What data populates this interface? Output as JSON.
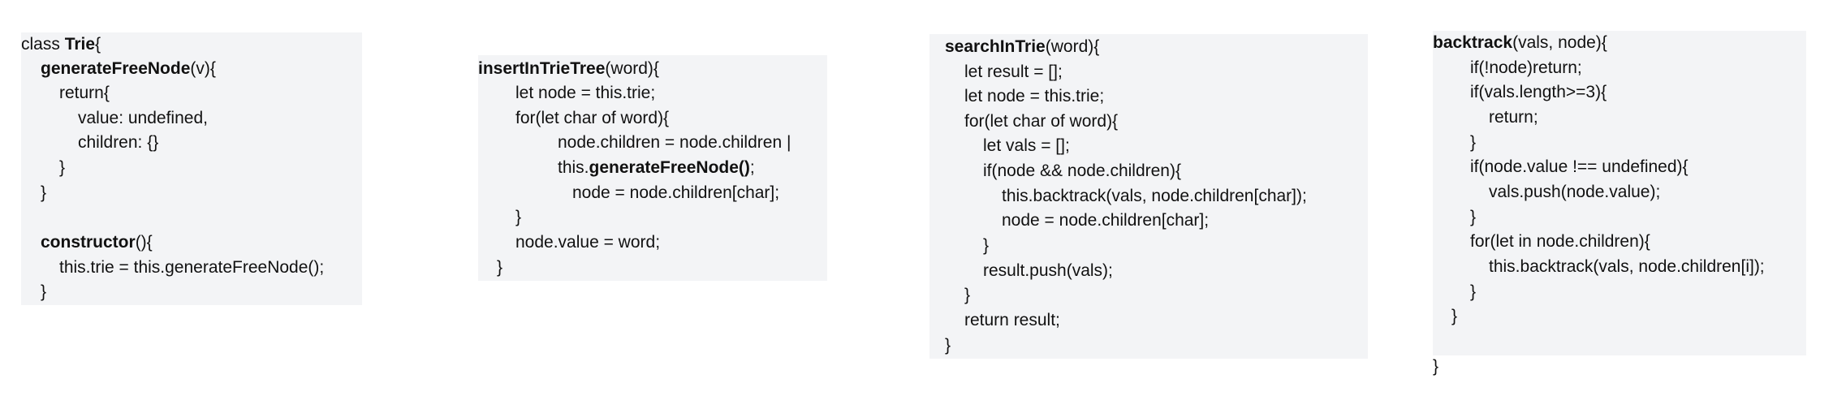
{
  "panels": [
    {
      "id": "trie-class",
      "lines": [
        [
          "class ",
          {
            "b": "Trie"
          },
          "{"
        ],
        [
          {
            "b": "generateFreeNode"
          },
          "(v){"
        ],
        [
          "return{"
        ],
        [
          "value: undefined,"
        ],
        [
          "children: {}"
        ],
        [
          "}"
        ],
        [
          "}"
        ],
        [
          ""
        ],
        [
          {
            "b": "constructor"
          },
          "(){"
        ],
        [
          "this.trie = this.generateFreeNode();"
        ],
        [
          "}"
        ]
      ]
    },
    {
      "id": "insert-in-trie-tree",
      "lines": [
        [
          {
            "b": "insertInTrieTree"
          },
          "(word){"
        ],
        [
          "let node = this.trie;"
        ],
        [
          "for(let char of word){"
        ],
        [
          "node.children = node.children |"
        ],
        [
          "this.",
          {
            "b": "generateFreeNode()"
          },
          ";"
        ],
        [
          "node = node.children[char];"
        ],
        [
          "}"
        ],
        [
          "node.value = word;"
        ],
        [
          "}"
        ]
      ]
    },
    {
      "id": "search-in-trie",
      "lines": [
        [
          {
            "b": "searchInTrie"
          },
          "(word){"
        ],
        [
          "let result = [];"
        ],
        [
          "let node = this.trie;"
        ],
        [
          "for(let char of word){"
        ],
        [
          "let vals = [];"
        ],
        [
          "if(node && node.children){"
        ],
        [
          "this.backtrack(vals, node.children[char]);"
        ],
        [
          "node = node.children[char];"
        ],
        [
          "}"
        ],
        [
          "result.push(vals);"
        ],
        [
          "}"
        ],
        [
          "return result;"
        ],
        [
          "}"
        ]
      ]
    },
    {
      "id": "backtrack",
      "lines": [
        [
          {
            "b": "backtrack"
          },
          "(vals, node){"
        ],
        [
          "if(!node)return;"
        ],
        [
          "if(vals.length>=3){"
        ],
        [
          "return;"
        ],
        [
          "}"
        ],
        [
          "if(node.value !== undefined){"
        ],
        [
          "vals.push(node.value);"
        ],
        [
          "}"
        ],
        [
          "for(let in node.children){"
        ],
        [
          "this.backtrack(vals, node.children[i]);"
        ],
        [
          "}"
        ],
        [
          "}"
        ],
        [
          ""
        ],
        [
          "}"
        ]
      ]
    }
  ]
}
